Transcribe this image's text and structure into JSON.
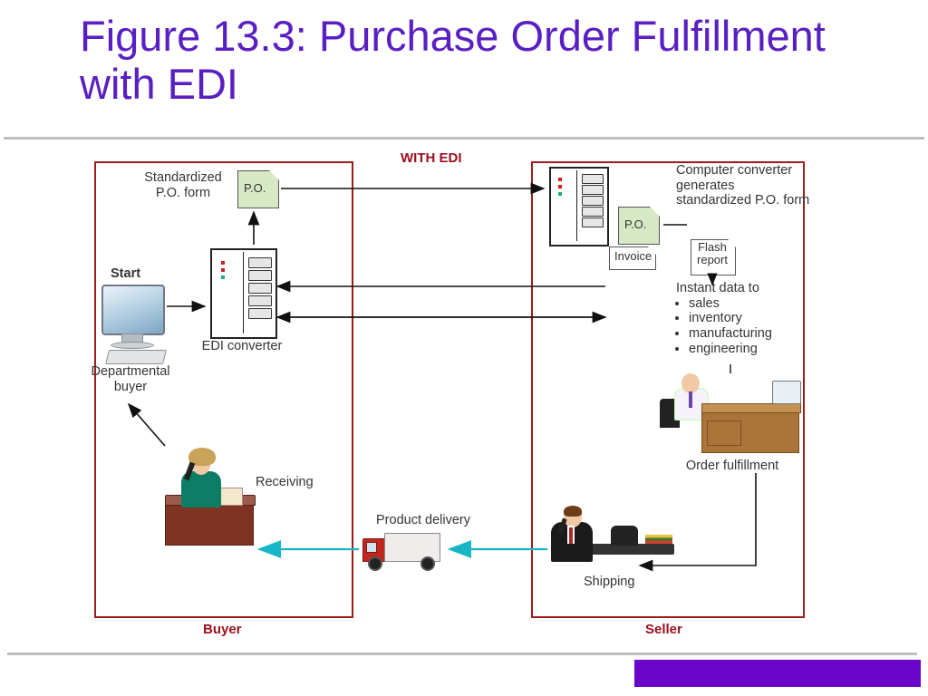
{
  "title": "Figure 13.3: Purchase Order Fulfillment with EDI",
  "header": "WITH EDI",
  "buyer": {
    "label": "Buyer",
    "start": "Start",
    "departmental_buyer": "Departmental buyer",
    "edi_converter": "EDI converter",
    "standardized_po": "Standardized P.O. form",
    "po_abbrev": "P.O.",
    "receiving": "Receiving"
  },
  "seller": {
    "label": "Seller",
    "computer_converter": "Computer converter generates standardized P.O. form",
    "po_abbrev": "P.O.",
    "invoice": "Invoice",
    "flash_report": "Flash report",
    "instant_data_head": "Instant data to",
    "instant_data": [
      "sales",
      "inventory",
      "manufacturing",
      "engineering"
    ],
    "order_fulfillment": "Order fulfillment",
    "shipping": "Shipping"
  },
  "transit": {
    "product_delivery": "Product delivery"
  }
}
